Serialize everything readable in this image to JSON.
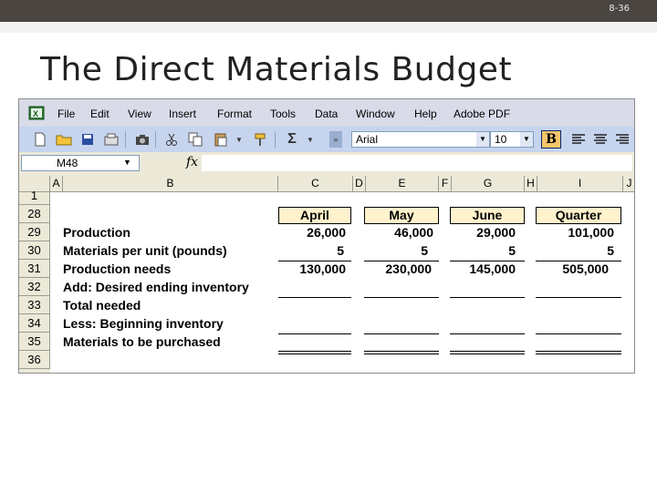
{
  "slide": {
    "number": "8-36",
    "title": "The Direct Materials Budget"
  },
  "menu": [
    "File",
    "Edit",
    "View",
    "Insert",
    "Format",
    "Tools",
    "Data",
    "Window",
    "Help",
    "Adobe PDF"
  ],
  "toolbar": {
    "font_name": "Arial",
    "font_size": "10",
    "bold_label": "B",
    "sum_symbol": "Σ"
  },
  "formula_bar": {
    "name_box": "M48",
    "fx_label": "fx"
  },
  "columns": [
    "A",
    "B",
    "C",
    "D",
    "E",
    "F",
    "G",
    "H",
    "I",
    "J"
  ],
  "rows": [
    "1",
    "28",
    "29",
    "30",
    "31",
    "32",
    "33",
    "34",
    "35",
    "36"
  ],
  "table": {
    "headers": [
      "April",
      "May",
      "June",
      "Quarter"
    ],
    "row_labels": [
      "Production",
      "Materials per unit (pounds)",
      "Production needs",
      "Add: Desired ending inventory",
      "Total needed",
      "Less: Beginning inventory",
      "Materials to be purchased"
    ],
    "production": [
      "26,000",
      "46,000",
      "29,000",
      "101,000"
    ],
    "materials_per_unit": [
      "5",
      "5",
      "5",
      "5"
    ],
    "production_needs": [
      "130,000",
      "230,000",
      "145,000",
      "505,000"
    ]
  },
  "colors": {
    "header_fill": "#fff2cc",
    "menubar": "#d9dbe9",
    "toolbar": "#c6d4ee",
    "title_bar": "#4a4540"
  }
}
